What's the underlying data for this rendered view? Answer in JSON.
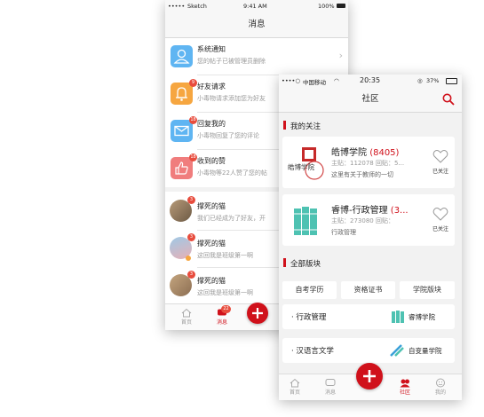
{
  "back_phone": {
    "status": {
      "carrier": "Sketch",
      "time": "9:41 AM",
      "battery": "100%"
    },
    "title": "消息",
    "notifications": [
      {
        "title": "系统通知",
        "subtitle": "您的帖子已被管理员删除",
        "color": "#5fb5f2",
        "icon": "user-icon",
        "badge": ""
      },
      {
        "title": "好友请求",
        "subtitle": "小毒物请求添加您为好友",
        "color": "#f6a640",
        "icon": "bell-icon",
        "badge": "9"
      },
      {
        "title": "回复我的",
        "subtitle": "小毒物回复了您的评论",
        "color": "#5fb5f2",
        "icon": "mail-icon",
        "badge": "18"
      },
      {
        "title": "收到的赞",
        "subtitle": "小毒物等22人赞了您的帖",
        "color": "#f07d7d",
        "icon": "thumbs-up-icon",
        "badge": "18"
      }
    ],
    "chats": [
      {
        "name": "撑死的猫",
        "message": "我们已经成为了好友，开",
        "badge": "3"
      },
      {
        "name": "撑死的猫",
        "message": "这回我是班级第一啊",
        "badge": "3"
      },
      {
        "name": "撑死的猫",
        "message": "这回我是班级第一啊",
        "badge": "3"
      }
    ],
    "tabs": {
      "home": "首页",
      "messages": "消息",
      "messages_badge": "22"
    }
  },
  "front_phone": {
    "status": {
      "carrier": "中国移动",
      "time": "20:35",
      "battery": "37%"
    },
    "title": "社区",
    "my_follow_heading": "我的关注",
    "followed": [
      {
        "name": "皓博学院",
        "count": "(8405)",
        "stats": "主贴：112078  回贴：5...",
        "desc": "这里有关于教师的一切",
        "follow_label": "已关注",
        "logo_text": "皓博学院"
      },
      {
        "name": "睿博-行政管理",
        "count": "(3...",
        "stats": "主贴：273080  回贴：",
        "desc": "行政管理",
        "follow_label": "已关注"
      }
    ],
    "all_heading": "全部版块",
    "categories": [
      "自考学历",
      "资格证书",
      "学院版块"
    ],
    "boards": [
      {
        "name": "· 行政管理",
        "brand": "睿博学院"
      },
      {
        "name": "· 汉语言文学",
        "brand": "自变量学院"
      }
    ],
    "tabs": {
      "home": "首页",
      "messages": "消息",
      "community": "社区",
      "mine": "我的"
    },
    "colors": {
      "accent": "#d0111b",
      "green": "#4ec2b2"
    }
  }
}
